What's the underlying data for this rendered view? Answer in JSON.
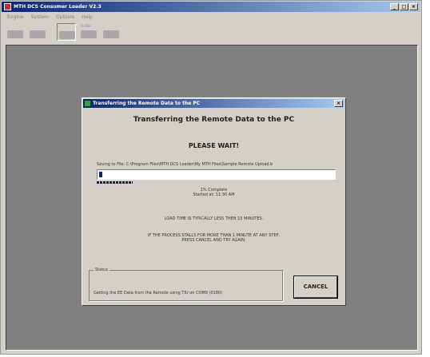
{
  "window": {
    "title": "MTH DCS Consumer Loader V2.3",
    "minimize": "_",
    "maximize": "□",
    "close": "×"
  },
  "menu": [
    "Engine",
    "System",
    "Options",
    "Help"
  ],
  "toolbar": {
    "buttons": [
      {
        "icon": "engine-icon"
      },
      {
        "icon": "remote-icon"
      },
      {
        "icon": "engine-to-remote-icon",
        "active": true
      },
      {
        "icon": "flash-engine-icon",
        "caption": "FLASH"
      },
      {
        "icon": "flash-tiu-icon"
      }
    ]
  },
  "dialog": {
    "title": "Transferring the Remote Data to the PC",
    "close": "×",
    "heading": "Transferring the Remote Data to the PC",
    "wait": "PLEASE WAIT!",
    "saving": "Saving to File: C:\\Program Files\\MTH DCS Loader\\My MTH Files\\Sample Remote Upload.b",
    "progress": 0.01,
    "percent_text": "1% Complete",
    "started": "Started at: 11:30 AM",
    "load_time": "LOAD TIME IS TYPICALLY LESS THEN 15 MINUTES.",
    "stall_line1": "IF THE PROCESS STALLS FOR MORE THAN 1 MINUTE AT ANY STEP,",
    "stall_line2": "PRESS CANCEL AND TRY AGAIN.",
    "status_label": "Status",
    "status_text": "Getting the EE Data from the Remote using TIU  on COM9  (0180)",
    "cancel": "CANCEL"
  },
  "colors": {
    "titlebar": "#0a246a",
    "progress": "#0a246a"
  }
}
